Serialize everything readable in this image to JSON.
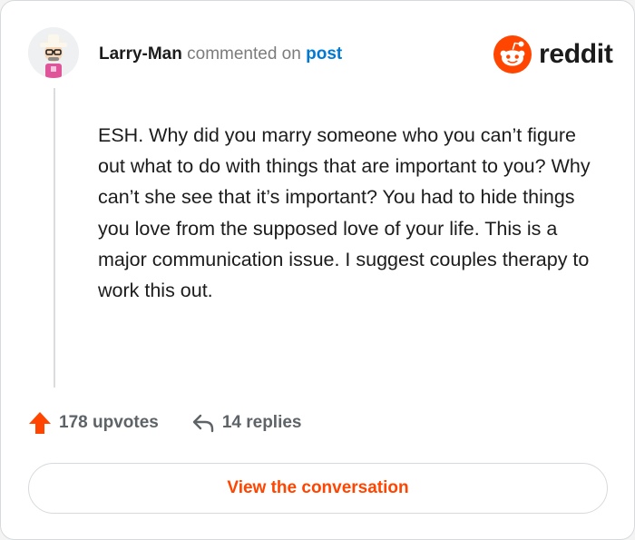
{
  "comment": {
    "username": "Larry-Man",
    "verb": "commented on",
    "link_label": "post",
    "body": "ESH. Why did you marry someone who you can’t figure out what to do with things that are important to you? Why can’t she see that it’s important? You had to hide things you love from the supposed love of your life. This is a major communication issue. I suggest couples therapy to work this out."
  },
  "brand": {
    "wordmark": "reddit",
    "accent_color": "#ff4500"
  },
  "stats": {
    "upvotes_label": "178 upvotes",
    "replies_label": "14 replies"
  },
  "cta": {
    "label": "View the conversation"
  },
  "icons": {
    "avatar": "user-avatar",
    "brand": "reddit-logo-icon",
    "upvote": "upvote-arrow-icon",
    "reply": "reply-arrow-icon"
  }
}
